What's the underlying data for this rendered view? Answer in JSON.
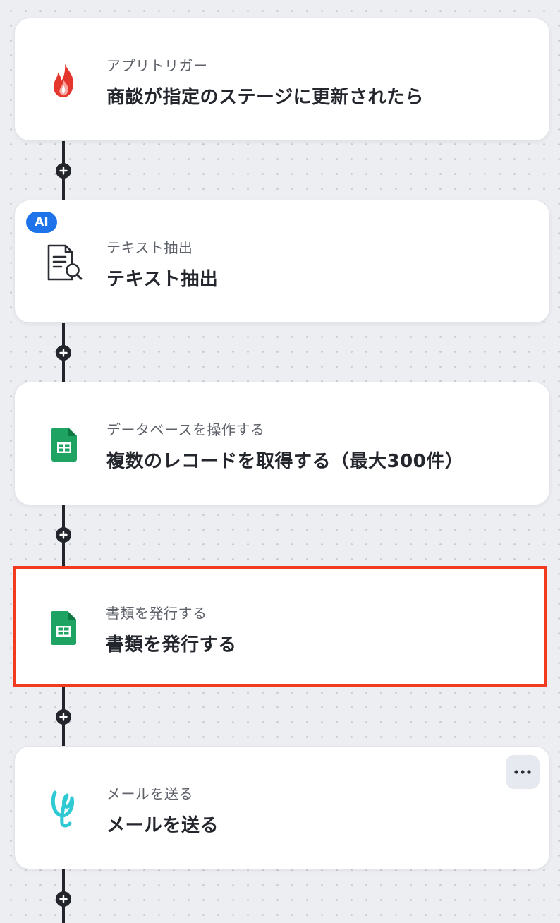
{
  "steps": [
    {
      "subtitle": "アプリトリガー",
      "title": "商談が指定のステージに更新されたら",
      "icon": "flame-icon"
    },
    {
      "subtitle": "テキスト抽出",
      "title": "テキスト抽出",
      "icon": "document-search-icon",
      "badge": "AI"
    },
    {
      "subtitle": "データベースを操作する",
      "title": "複数のレコードを取得する（最大300件）",
      "icon": "google-sheets-icon"
    },
    {
      "subtitle": "書類を発行する",
      "title": "書類を発行する",
      "icon": "google-sheets-icon",
      "selected": true
    },
    {
      "subtitle": "メールを送る",
      "title": "メールを送る",
      "icon": "mail-app-icon"
    }
  ],
  "colors": {
    "background": "#eceef2",
    "connector": "#23252c",
    "selection_border": "#f23a1f",
    "ai_badge": "#1f73ea",
    "sheets_green": "#1ea362",
    "flame_red": "#e5362e",
    "mail_teal": "#2ec9d3"
  }
}
